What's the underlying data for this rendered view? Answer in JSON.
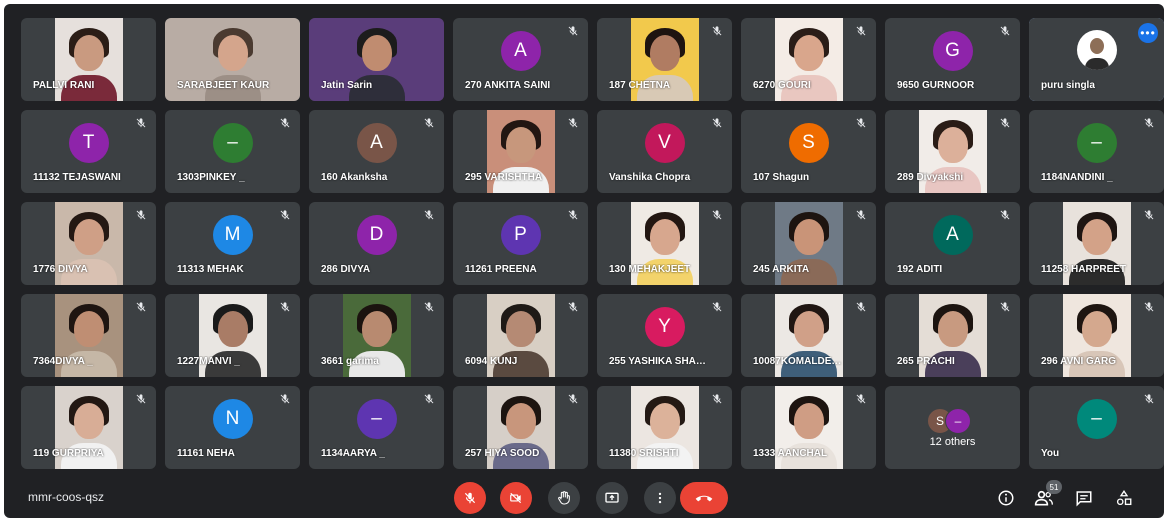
{
  "meeting": {
    "code": "mmr-coos-qsz",
    "participants_badge": "51"
  },
  "tiles": [
    {
      "name": "PALLVI RANI",
      "type": "video",
      "skin": "#c99a80",
      "hair": "#2b1d16",
      "shirt": "#7a2a3a",
      "bg": "#e6e0dc",
      "mute": false
    },
    {
      "name": "SARABJEET KAUR",
      "type": "video-wide",
      "skin": "#d4a58c",
      "hair": "#4a3a30",
      "shirt": "#9c8f86",
      "bg": "#b8aca4",
      "mute": false
    },
    {
      "name": "Jatin Sarin",
      "type": "video-wide",
      "skin": "#c08c70",
      "hair": "#1c1c1c",
      "shirt": "#2e2e3a",
      "bg": "#5a3d7a",
      "mute": false
    },
    {
      "name": "270 ANKITA SAINI",
      "type": "avatar",
      "letter": "A",
      "color": "#8e24aa",
      "mute": true
    },
    {
      "name": "187 CHETNA",
      "type": "video",
      "skin": "#b07c62",
      "hair": "#1e1410",
      "shirt": "#d8c9b5",
      "bg": "#f2c94c",
      "mute": true
    },
    {
      "name": "6270 GOURI",
      "type": "video",
      "skin": "#d9a68c",
      "hair": "#2a1d18",
      "shirt": "#e9c7c0",
      "bg": "#f4ece6",
      "mute": true
    },
    {
      "name": "9650 GURNOOR",
      "type": "avatar",
      "letter": "G",
      "color": "#8e24aa",
      "mute": true
    },
    {
      "name": "puru singla",
      "type": "photo",
      "skin": "#8d6e57",
      "hair": "#2b2b2b",
      "shirt": "#c9c9c9",
      "bg": "#ffffff",
      "mute": false,
      "active": true
    },
    {
      "name": "11132 TEJASWANI",
      "type": "avatar",
      "letter": "T",
      "color": "#8e24aa",
      "mute": true
    },
    {
      "name": "1303PINKEY _",
      "type": "avatar",
      "letter": "–",
      "color": "#2e7d32",
      "mute": true
    },
    {
      "name": "160 Akanksha",
      "type": "avatar",
      "letter": "A",
      "color": "#795548",
      "mute": true
    },
    {
      "name": "295 VARISHTHA",
      "type": "video",
      "skin": "#c7977c",
      "hair": "#221612",
      "shirt": "#f0f0f0",
      "bg": "#c98f7a",
      "mute": true
    },
    {
      "name": "Vanshika Chopra",
      "type": "avatar",
      "letter": "V",
      "color": "#c2185b",
      "mute": true
    },
    {
      "name": "107 Shagun",
      "type": "avatar",
      "letter": "S",
      "color": "#ef6c00",
      "mute": true
    },
    {
      "name": "289 Divyakshi",
      "type": "video",
      "skin": "#dcb09a",
      "hair": "#2a1c16",
      "shirt": "#e8c6c2",
      "bg": "#f1ece8",
      "mute": true
    },
    {
      "name": "1184NANDINI _",
      "type": "avatar",
      "letter": "–",
      "color": "#2e7d32",
      "mute": true
    },
    {
      "name": "1776 DIVYA",
      "type": "video",
      "skin": "#cf9f86",
      "hair": "#241813",
      "shirt": "#d9c1b2",
      "bg": "#c9b8aa",
      "mute": true
    },
    {
      "name": "11313 MEHAK",
      "type": "avatar",
      "letter": "M",
      "color": "#1e88e5",
      "mute": true
    },
    {
      "name": "286 DIVYA",
      "type": "avatar",
      "letter": "D",
      "color": "#8e24aa",
      "mute": true
    },
    {
      "name": "11261 PREENA",
      "type": "avatar",
      "letter": "P",
      "color": "#5e35b1",
      "mute": true
    },
    {
      "name": "130 MEHAKJEET",
      "type": "video",
      "skin": "#d7a78e",
      "hair": "#231712",
      "shirt": "#f3d36b",
      "bg": "#efeae4",
      "mute": true
    },
    {
      "name": "245 ARKITA",
      "type": "video",
      "skin": "#c99478",
      "hair": "#1d1410",
      "shirt": "#8a6a58",
      "bg": "#6f7a86",
      "mute": true
    },
    {
      "name": "192 ADITI",
      "type": "avatar",
      "letter": "A",
      "color": "#00695c",
      "mute": true
    },
    {
      "name": "11258 HARPREET",
      "type": "video",
      "skin": "#d3a288",
      "hair": "#1e1512",
      "shirt": "#2c2c2c",
      "bg": "#e8e2dc",
      "mute": true
    },
    {
      "name": "7364DIVYA _",
      "type": "video",
      "skin": "#bf8e73",
      "hair": "#1f1511",
      "shirt": "#c5b7a6",
      "bg": "#a8927e",
      "mute": true
    },
    {
      "name": "1227MANVI _",
      "type": "video",
      "skin": "#a97c66",
      "hair": "#1a1a1a",
      "shirt": "#3a3a3a",
      "bg": "#e9e6e2",
      "mute": true
    },
    {
      "name": "3661 garima",
      "type": "video",
      "skin": "#b88a70",
      "hair": "#1b130f",
      "shirt": "#e8e8e8",
      "bg": "#4a6a3a",
      "mute": true
    },
    {
      "name": "6094 KUNJ",
      "type": "video",
      "skin": "#b58a74",
      "hair": "#1f1a16",
      "shirt": "#5a4a40",
      "bg": "#d8cfc4",
      "mute": true
    },
    {
      "name": "255 YASHIKA SHA…",
      "type": "avatar",
      "letter": "Y",
      "color": "#d81b60",
      "mute": true
    },
    {
      "name": "10087KOMALDE…",
      "type": "video",
      "skin": "#d0a088",
      "hair": "#201612",
      "shirt": "#3f5f7a",
      "bg": "#ece8e4",
      "mute": true
    },
    {
      "name": "265 PRACHI",
      "type": "video",
      "skin": "#c89a80",
      "hair": "#1c1410",
      "shirt": "#4a3f5a",
      "bg": "#e4ddd6",
      "mute": true
    },
    {
      "name": "296 AVNI GARG",
      "type": "video",
      "skin": "#d4a88e",
      "hair": "#1e1511",
      "shirt": "#d8c6b8",
      "bg": "#efe6de",
      "mute": true
    },
    {
      "name": "119 GURPRIYA",
      "type": "video",
      "skin": "#d8ad96",
      "hair": "#231813",
      "shirt": "#f1f1f1",
      "bg": "#d9d2cc",
      "mute": true
    },
    {
      "name": "11161 NEHA",
      "type": "avatar",
      "letter": "N",
      "color": "#1e88e5",
      "mute": true
    },
    {
      "name": "1134AARYA _",
      "type": "avatar",
      "letter": "–",
      "color": "#5e35b1",
      "mute": true
    },
    {
      "name": "257 HIYA SOOD",
      "type": "video",
      "skin": "#c8967c",
      "hair": "#1c1410",
      "shirt": "#6a6a8a",
      "bg": "#d6cfc8",
      "mute": true
    },
    {
      "name": "11380 SRISHTI",
      "type": "video",
      "skin": "#dcb29a",
      "hair": "#241914",
      "shirt": "#f3f3f3",
      "bg": "#ece6e1",
      "mute": true
    },
    {
      "name": "1333 AANCHAL",
      "type": "video",
      "skin": "#cf9d84",
      "hair": "#1d1410",
      "shirt": "#e8e2dc",
      "bg": "#f2eeea",
      "mute": true
    },
    {
      "name": "12 others",
      "type": "others",
      "mini": [
        {
          "letter": "S",
          "color": "#795548"
        },
        {
          "letter": "–",
          "color": "#8e24aa"
        }
      ],
      "mute": false
    },
    {
      "name": "You",
      "type": "avatar",
      "letter": "–",
      "color": "#00897b",
      "mute": true
    }
  ],
  "controls": {
    "mic": "mic-off",
    "camera": "camera-off",
    "raise_hand": "raise-hand",
    "present": "present-now",
    "more": "more-options",
    "leave": "leave-call"
  },
  "right_icons": [
    "meeting-details",
    "people",
    "chat",
    "activities"
  ]
}
